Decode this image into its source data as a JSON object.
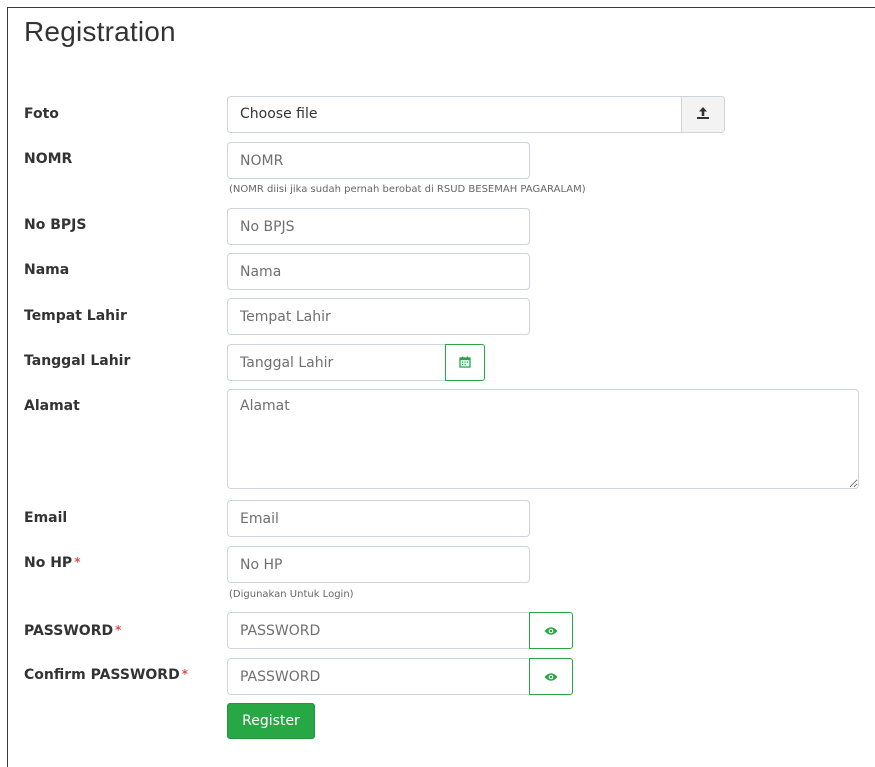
{
  "page": {
    "title": "Registration"
  },
  "form": {
    "foto": {
      "label": "Foto",
      "file_text": "Choose file"
    },
    "nomr": {
      "label": "NOMR",
      "placeholder": "NOMR",
      "help": "(NOMR diisi jika sudah pernah berobat di RSUD BESEMAH PAGARALAM)"
    },
    "bpjs": {
      "label": "No BPJS",
      "placeholder": "No BPJS"
    },
    "nama": {
      "label": "Nama",
      "placeholder": "Nama"
    },
    "tempat_lahir": {
      "label": "Tempat Lahir",
      "placeholder": "Tempat Lahir"
    },
    "tanggal_lahir": {
      "label": "Tanggal Lahir",
      "placeholder": "Tanggal Lahir"
    },
    "alamat": {
      "label": "Alamat",
      "placeholder": "Alamat"
    },
    "email": {
      "label": "Email",
      "placeholder": "Email"
    },
    "no_hp": {
      "label": "No HP",
      "required_mark": "*",
      "placeholder": "No HP",
      "help": "(Digunakan Untuk Login)"
    },
    "password": {
      "label": "PASSWORD",
      "required_mark": "*",
      "placeholder": "PASSWORD"
    },
    "confirm_password": {
      "label": "Confirm PASSWORD",
      "required_mark": "*",
      "placeholder": "PASSWORD"
    },
    "register_label": "Register"
  },
  "icons": {
    "upload": "upload-icon",
    "calendar": "calendar-icon",
    "eye": "eye-icon"
  },
  "colors": {
    "accent": "#28a745",
    "required": "#d9534f",
    "border": "#cfd4da"
  }
}
